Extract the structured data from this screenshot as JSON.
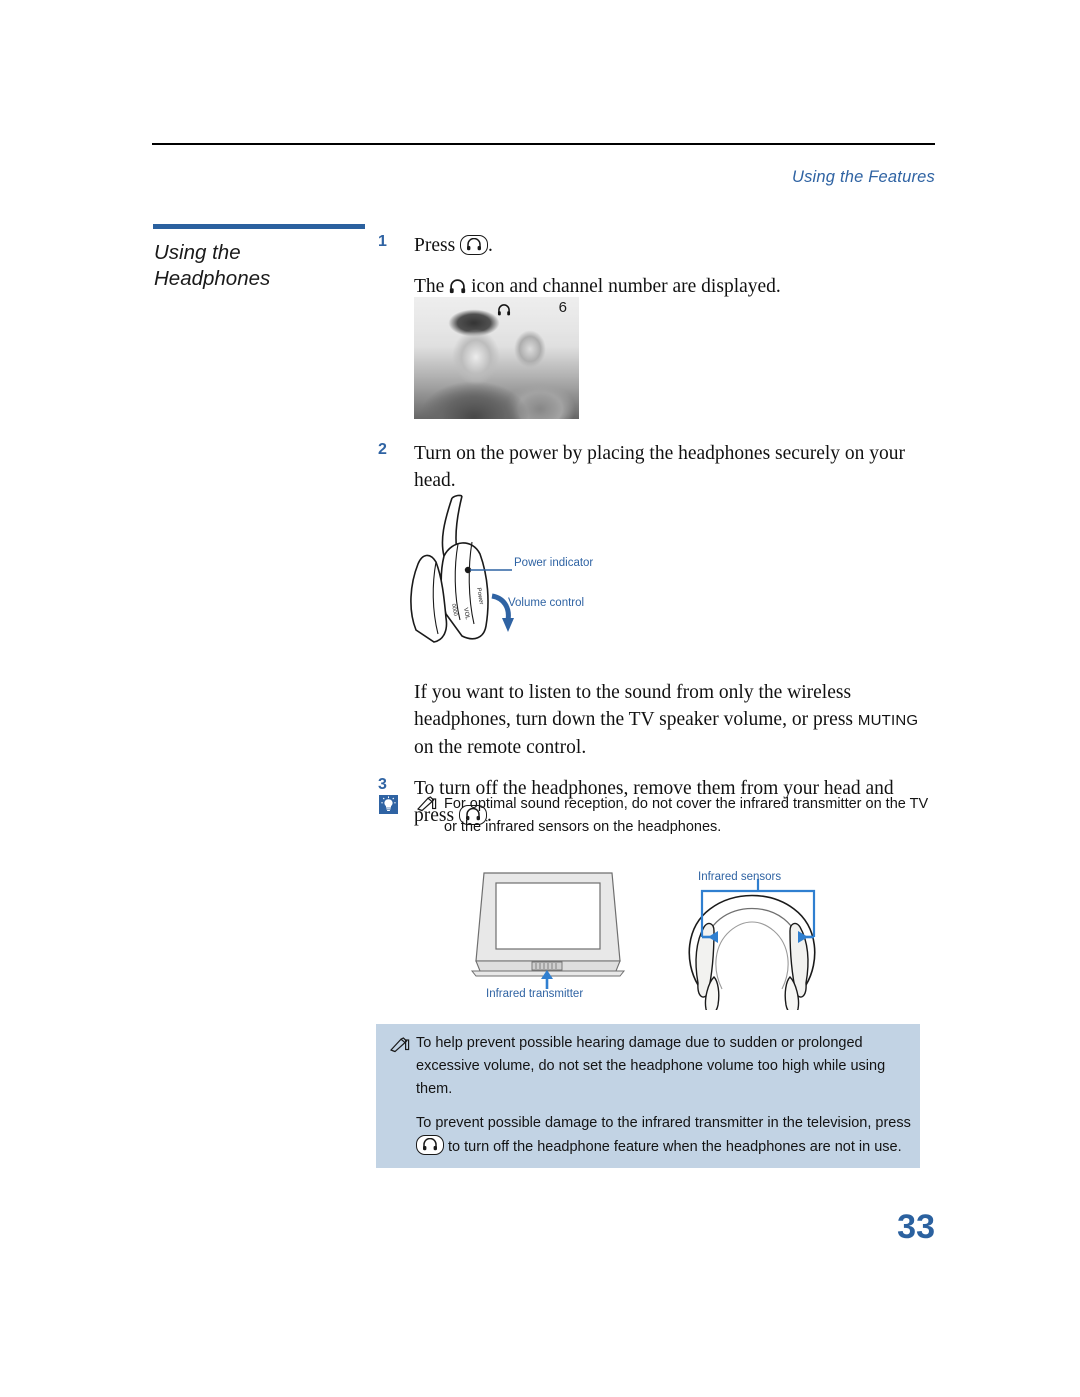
{
  "header": {
    "running_head": "Using the Features",
    "rule_color": "#000000"
  },
  "section": {
    "title_line1": "Using the",
    "title_line2": "Headphones",
    "accent_color": "#2b619f"
  },
  "steps": [
    {
      "number": "1",
      "text_before": "Press",
      "icon": "headphone-key-icon",
      "text_after": ".",
      "note_before": "The",
      "note_icon": "headphone-icon",
      "note_after": "icon and channel number are displayed."
    },
    {
      "number": "2",
      "text": "Turn on the power by placing the headphones securely on your head."
    },
    {
      "number": "3",
      "text_before": "To turn off the headphones, remove them from your head and press",
      "icon": "headphone-key-icon",
      "text_after": "."
    }
  ],
  "paragraph_wireless": {
    "part1": "If you want to listen to the sound from only the wireless headphones, turn down the TV speaker volume, or press ",
    "keyword": "MUTING",
    "part2": " on the remote control."
  },
  "tv_screen": {
    "channel_number": "6",
    "osd_icon": "headphone-icon",
    "photo_alt": "grayscale-photo-two-people"
  },
  "headphone_diagram": {
    "label_power": "Power indicator",
    "label_volume": "Volume control",
    "label_color": "#2f63a3"
  },
  "tip_note": {
    "bulb_icon": "lightbulb-tip-icon",
    "pencil_icon": "note-pencil-icon",
    "text": "For optimal sound reception, do not cover the infrared transmitter on the TV or the infrared sensors on the headphones."
  },
  "figure": {
    "label_transmitter": "Infrared transmitter",
    "label_sensors": "Infrared sensors",
    "label_color": "#2f63a3"
  },
  "warning_box": {
    "background_color": "#c2d3e4",
    "pencil_icon": "note-pencil-icon",
    "paragraph1": "To help prevent possible hearing damage due to sudden or prolonged excessive volume, do not set the headphone volume too high while using them.",
    "paragraph2_before": "To prevent possible damage to the infrared transmitter in the television, press",
    "paragraph2_icon": "headphone-key-icon",
    "paragraph2_after": "to turn off the headphone feature when the headphones are not in use."
  },
  "footer": {
    "page_number": "33",
    "page_number_color": "#2b619f"
  }
}
